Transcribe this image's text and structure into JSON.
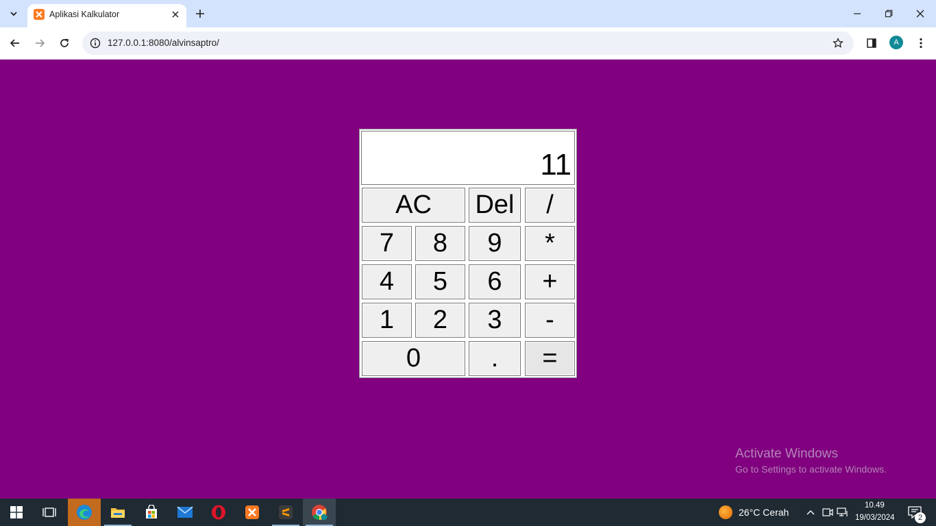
{
  "browser": {
    "tab_title": "Aplikasi Kalkulator",
    "url": "127.0.0.1:8080/alvinsaptro/",
    "profile_initial": "A"
  },
  "calculator": {
    "display": "11",
    "keys": {
      "ac": "AC",
      "del": "Del",
      "divide": "/",
      "seven": "7",
      "eight": "8",
      "nine": "9",
      "multiply": "*",
      "four": "4",
      "five": "5",
      "six": "6",
      "plus": "+",
      "one": "1",
      "two": "2",
      "three": "3",
      "minus": "-",
      "zero": "0",
      "dot": ".",
      "equals": "="
    }
  },
  "watermark": {
    "line1": "Activate Windows",
    "line2": "Go to Settings to activate Windows."
  },
  "taskbar": {
    "weather": "26°C  Cerah",
    "time": "10.49",
    "date": "19/03/2024",
    "notification_count": "2"
  },
  "colors": {
    "page_background": "#800080",
    "tab_strip": "#d3e3fd",
    "taskbar": "#1f2a33"
  }
}
